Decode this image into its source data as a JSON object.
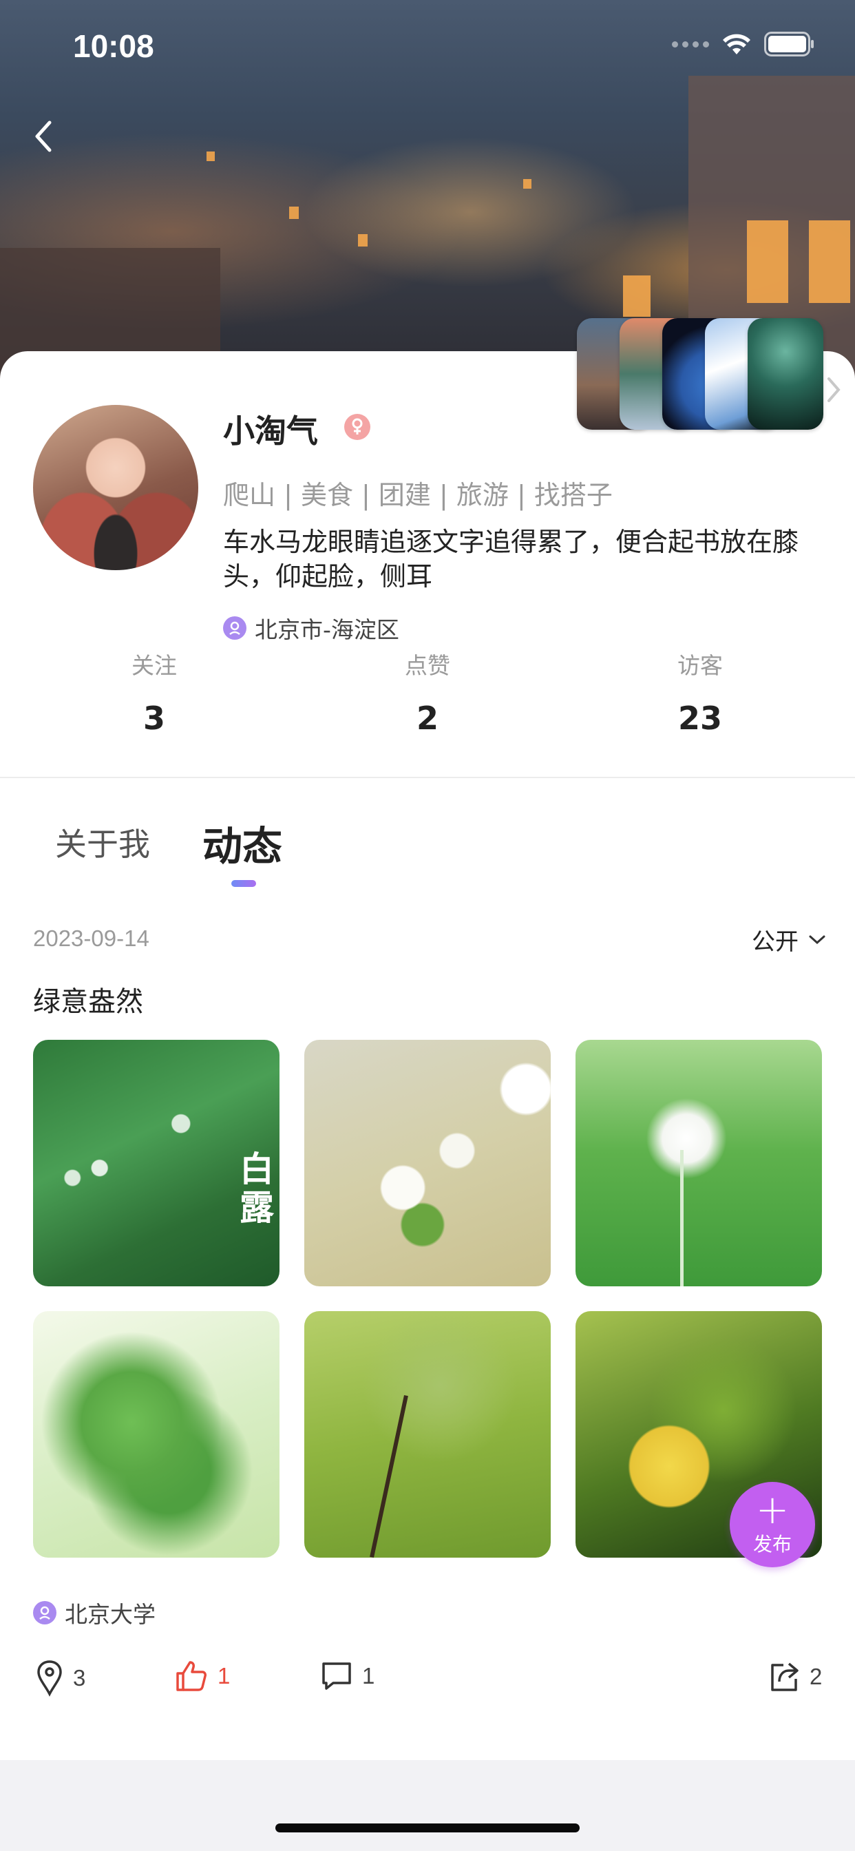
{
  "status_bar": {
    "time": "10:08"
  },
  "profile": {
    "name": "小淘气",
    "tags": "爬山 | 美食 | 团建 | 旅游 | 找搭子",
    "bio": "车水马龙眼睛追逐文字追得累了，便合起书放在膝头，仰起脸，侧耳",
    "location": "北京市-海淀区"
  },
  "stats": [
    {
      "label": "关注",
      "value": "3"
    },
    {
      "label": "点赞",
      "value": "2"
    },
    {
      "label": "访客",
      "value": "23"
    }
  ],
  "tabs": {
    "about": "关于我",
    "moments": "动态"
  },
  "post": {
    "date": "2023-09-14",
    "visibility": "公开",
    "text": "绿意盎然",
    "image1_caption": "白露",
    "location": "北京大学",
    "actions": {
      "views": "3",
      "likes": "1",
      "comments": "1",
      "shares": "2"
    }
  },
  "fab": {
    "label": "发布"
  },
  "colors": {
    "accent": "#c25ff0",
    "like": "#e84a3c",
    "location_pin": "#a98af0"
  }
}
